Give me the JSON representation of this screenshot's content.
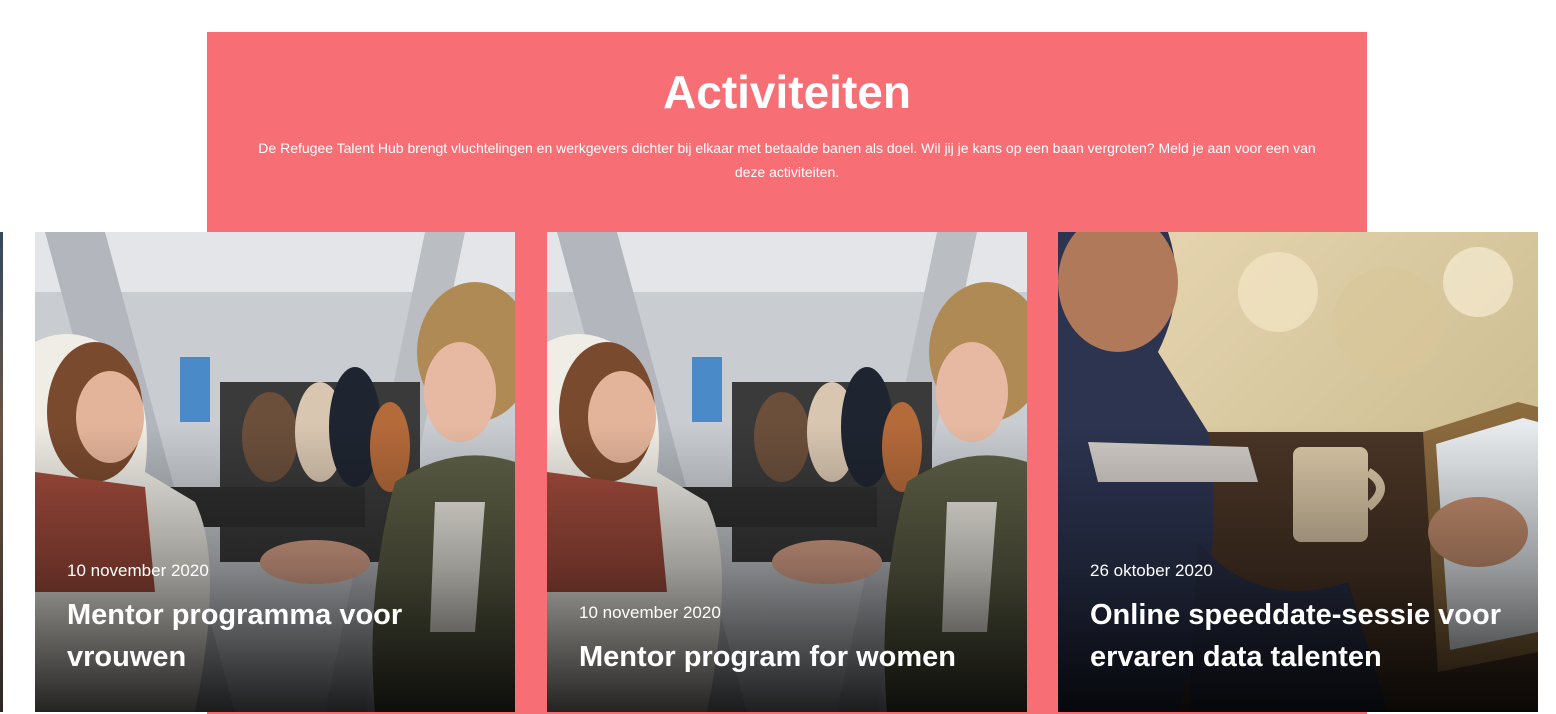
{
  "section": {
    "title": "Activiteiten",
    "intro": "De Refugee Talent Hub brengt vluchtelingen en werkgevers dichter bij elkaar met betaalde banen als doel. Wil jij je kans op een baan vergroten? Meld je aan voor een van deze activiteiten.",
    "background_color": "#f76f75"
  },
  "cards": [
    {
      "date": "10 november 2020",
      "title": "Mentor programma voor vrouwen",
      "image": "photo-two-women-talking"
    },
    {
      "date": "10 november 2020",
      "title": "Mentor program for women",
      "image": "photo-two-women-talking"
    },
    {
      "date": "26 oktober 2020",
      "title": "Online speeddate-sessie voor ervaren data talenten",
      "image": "photo-man-using-tablet"
    }
  ]
}
